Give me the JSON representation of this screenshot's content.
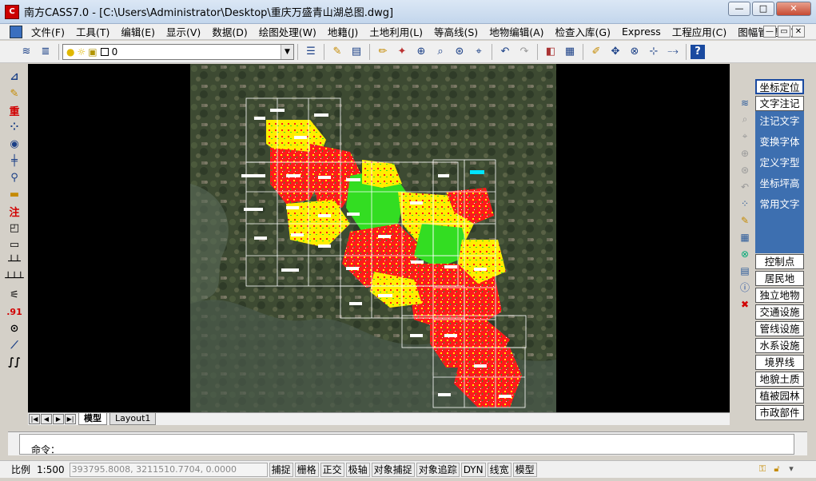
{
  "window": {
    "title": "南方CASS7.0 - [C:\\Users\\Administrator\\Desktop\\重庆万盛青山湖总图.dwg]",
    "app_icon": "cass-logo-icon",
    "buttons": [
      "—",
      "□",
      "✕"
    ]
  },
  "menu": {
    "items": [
      "文件(F)",
      "工具(T)",
      "编辑(E)",
      "显示(V)",
      "数据(D)",
      "绘图处理(W)",
      "地籍(J)",
      "土地利用(L)",
      "等高线(S)",
      "地物编辑(A)",
      "检查入库(G)",
      "Express",
      "工程应用(C)",
      "图幅管理(M)"
    ],
    "mdi_buttons": [
      "—",
      "▭",
      "✕"
    ]
  },
  "toolbar": {
    "layer_value": "0",
    "icons": [
      "layers-icon",
      "layer-manager-icon",
      "bulb-icon",
      "sun-icon",
      "lock-icon",
      "color-icon",
      "linetype-icon",
      "open-icon",
      "save-icon",
      "pencil-icon",
      "brush-icon",
      "zoom-window-icon",
      "zoom-realtime-icon",
      "zoom-in-icon",
      "zoom-previous-icon",
      "undo-icon",
      "redo-icon",
      "properties-icon",
      "calculator-icon",
      "draw-line-icon",
      "move-icon",
      "snap-icon",
      "dimension-icon",
      "polyline-icon",
      "help-icon"
    ]
  },
  "left_tools": {
    "labels": [
      "重",
      "注"
    ],
    "icons": [
      "measure-point-icon",
      "edit-icon",
      "heavy-text-icon",
      "points-grid-icon",
      "camera-icon",
      "cross-line-icon",
      "survey-icon",
      "ruler-icon",
      "annotate-text-icon",
      "rectangle-corner-icon",
      "rectangle-icon",
      "dashed-line-icon",
      "hatch-line-icon",
      "network-icon",
      "elevation-icon",
      "circle-point-icon",
      "diagonal-line-icon",
      "wave-icon"
    ],
    "elevation_label": ".91"
  },
  "layout_tabs": {
    "nav": [
      "|◀",
      "◀",
      "▶",
      "▶|"
    ],
    "tabs": [
      "模型",
      "Layout1"
    ]
  },
  "right_panel": {
    "top_button": "坐标定位",
    "text_button": "文字注记",
    "blue_items": [
      "注记文字",
      "变换字体",
      "定义字型",
      "坐标坪高",
      "常用文字"
    ],
    "buttons": [
      "控制点",
      "居民地",
      "独立地物",
      "交通设施",
      "管线设施",
      "水系设施",
      "境界线",
      "地貌土质",
      "植被园林",
      "市政部件"
    ],
    "icons": [
      "layers-icon",
      "zoom-realtime-icon",
      "zoom-window-icon",
      "zoom-extent-icon",
      "zoom-in-icon",
      "zoom-previous-icon",
      "pattern-icon",
      "edit-pencil-icon",
      "grid-tool-icon",
      "network-icon",
      "calculator-icon",
      "info-icon",
      "delete-icon"
    ]
  },
  "command": {
    "prompt": "命令："
  },
  "status": {
    "scale_label": "比例",
    "scale_value": "1:500",
    "coordinates": "393795.8008, 3211510.7704, 0.0000",
    "toggles": [
      "捕捉",
      "栅格",
      "正交",
      "极轴",
      "对象捕捉",
      "对象追踪",
      "DYN",
      "线宽",
      "模型"
    ],
    "tray_icons": [
      "lock-key-icon",
      "lock-open-icon",
      "dropdown-arrow-icon"
    ]
  },
  "colors": {
    "canvas": "#000000",
    "panel_blue": "#3d6fb0",
    "red_fill": "#ff1a1a",
    "yellow_fill": "#ffee00",
    "green_fill": "#33dd22"
  }
}
